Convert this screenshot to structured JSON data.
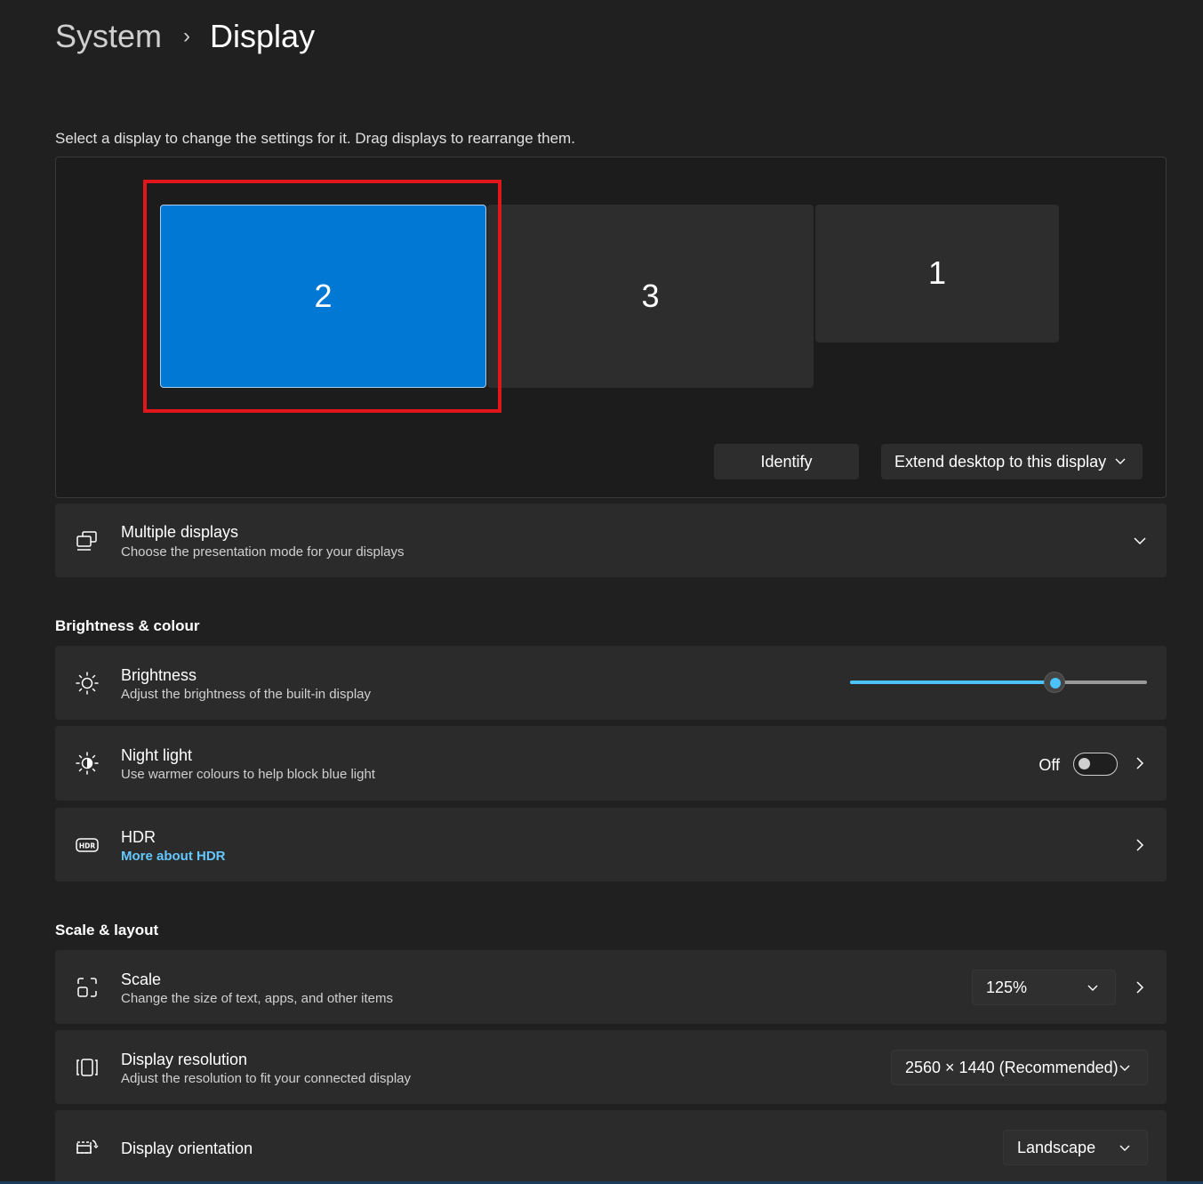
{
  "breadcrumb": {
    "parent": "System",
    "separator": "›",
    "current": "Display"
  },
  "intro": "Select a display to change the settings for it. Drag displays to rearrange them.",
  "monitors": [
    {
      "label": "2",
      "selected": true
    },
    {
      "label": "3",
      "selected": false
    },
    {
      "label": "1",
      "selected": false
    }
  ],
  "arrange_buttons": {
    "identify": "Identify",
    "extend": "Extend desktop to this display"
  },
  "multiple_displays": {
    "title": "Multiple displays",
    "subtitle": "Choose the presentation mode for your displays",
    "icon": "multiple-displays-icon"
  },
  "brightness_section": {
    "heading": "Brightness & colour",
    "brightness": {
      "title": "Brightness",
      "subtitle": "Adjust the brightness of the built-in display",
      "icon": "brightness-icon",
      "value_percent": 69
    },
    "night_light": {
      "title": "Night light",
      "subtitle": "Use warmer colours to help block blue light",
      "state_label": "Off",
      "icon": "night-light-icon"
    },
    "hdr": {
      "title": "HDR",
      "link": "More about HDR",
      "icon": "hdr-icon"
    }
  },
  "scale_section": {
    "heading": "Scale & layout",
    "scale": {
      "title": "Scale",
      "subtitle": "Change the size of text, apps, and other items",
      "value": "125%",
      "icon": "scale-icon"
    },
    "resolution": {
      "title": "Display resolution",
      "subtitle": "Adjust the resolution to fit your connected display",
      "value": "2560 × 1440 (Recommended)",
      "icon": "resolution-icon"
    },
    "orientation": {
      "title": "Display orientation",
      "value": "Landscape",
      "icon": "orientation-icon"
    }
  },
  "colors": {
    "accent": "#0078d4",
    "slider": "#4cc2ff",
    "link": "#64c8ff",
    "highlight": "#e0161b"
  }
}
